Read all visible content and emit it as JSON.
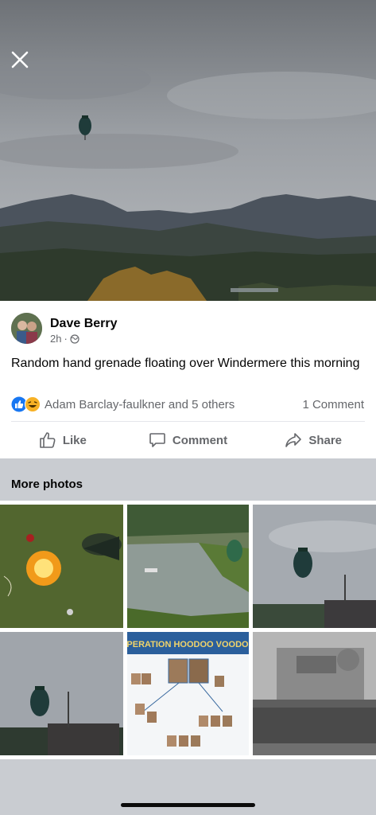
{
  "viewer": {
    "close_icon": "close-icon"
  },
  "post": {
    "author_name": "Dave Berry",
    "timestamp": "2h",
    "privacy_icon": "globe-icon",
    "caption": "Random hand grenade floating over Windermere this morning",
    "reactions": {
      "icons": [
        "like-icon",
        "haha-icon"
      ],
      "text": "Adam Barclay-faulkner and 5 others"
    },
    "comments_count": "1 Comment",
    "actions": {
      "like": "Like",
      "comment": "Comment",
      "share": "Share"
    }
  },
  "more_photos": {
    "title": "More photos",
    "poster_text": "OPERATION HOODOO VOODOO"
  },
  "colors": {
    "accent": "#1877f2",
    "haha": "#f7b125",
    "text_secondary": "#65676b",
    "background": "#c9ccd1"
  }
}
